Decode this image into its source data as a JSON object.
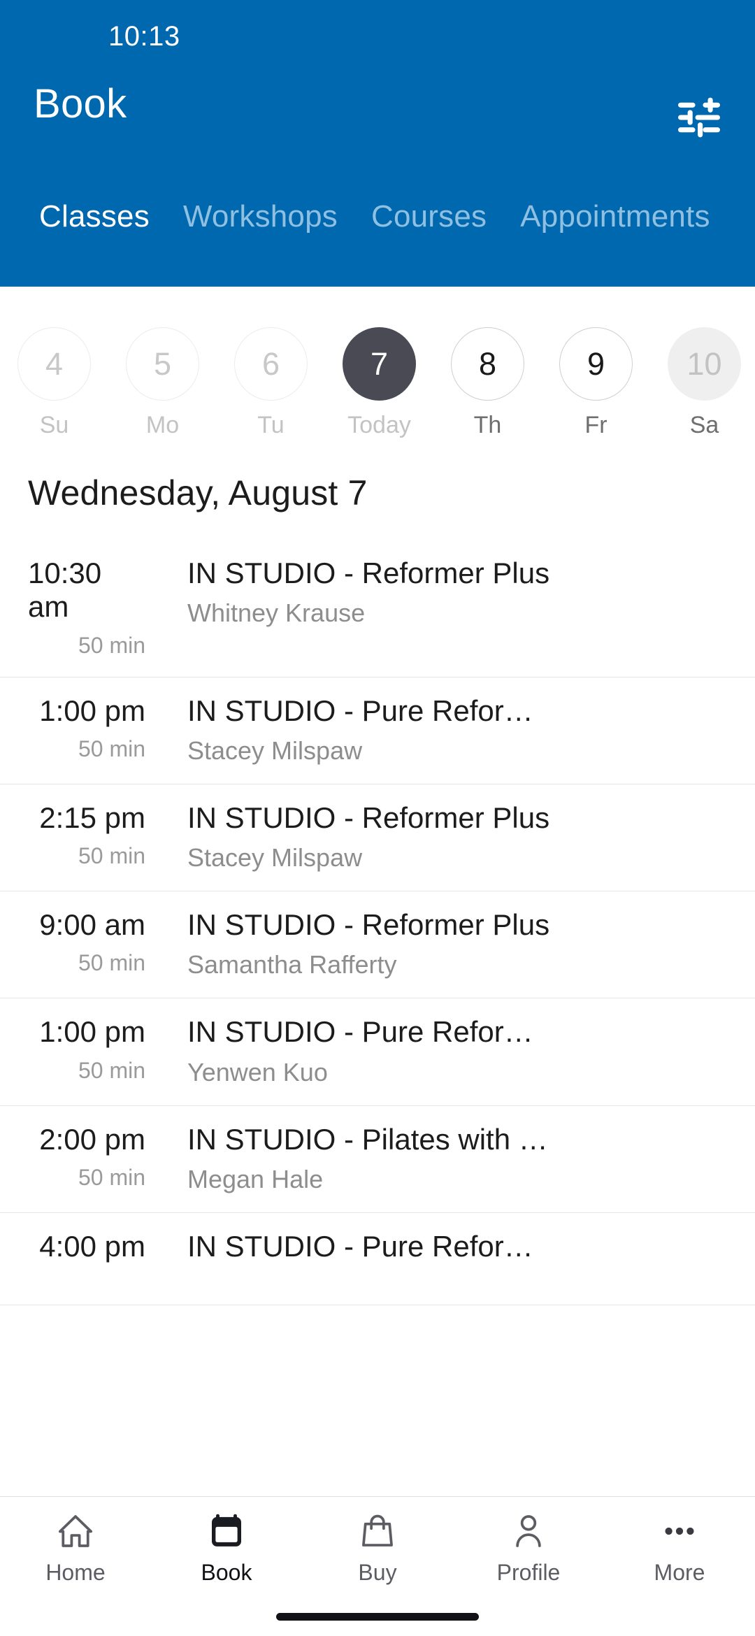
{
  "status_bar": {
    "time": "10:13"
  },
  "header": {
    "title": "Book",
    "filter_icon": "filter-tune-icon",
    "accent_color": "#0068AE",
    "tabs": [
      {
        "label": "Classes",
        "active": true
      },
      {
        "label": "Workshops",
        "active": false
      },
      {
        "label": "Courses",
        "active": false
      },
      {
        "label": "Appointments",
        "active": false
      }
    ]
  },
  "date_strip": {
    "days": [
      {
        "number": "4",
        "weekday": "Su",
        "state": "past"
      },
      {
        "number": "5",
        "weekday": "Mo",
        "state": "past"
      },
      {
        "number": "6",
        "weekday": "Tu",
        "state": "past"
      },
      {
        "number": "7",
        "weekday": "Today",
        "state": "selected"
      },
      {
        "number": "8",
        "weekday": "Th",
        "state": "future"
      },
      {
        "number": "9",
        "weekday": "Fr",
        "state": "future"
      },
      {
        "number": "10",
        "weekday": "Sa",
        "state": "disabled"
      }
    ],
    "selected_color": "#4A4A55"
  },
  "schedule": {
    "date_heading": "Wednesday, August 7",
    "classes": [
      {
        "time": "10:30 am",
        "duration": "50 min",
        "title": "IN STUDIO - Reformer Plus",
        "instructor": "Whitney Krause"
      },
      {
        "time": "1:00 pm",
        "duration": "50 min",
        "title": "IN STUDIO - Pure Refor…",
        "instructor": "Stacey Milspaw"
      },
      {
        "time": "2:15 pm",
        "duration": "50 min",
        "title": "IN STUDIO - Reformer Plus",
        "instructor": "Stacey Milspaw"
      },
      {
        "time": "9:00 am",
        "duration": "50 min",
        "title": "IN STUDIO - Reformer Plus",
        "instructor": "Samantha Rafferty"
      },
      {
        "time": "1:00 pm",
        "duration": "50 min",
        "title": "IN STUDIO - Pure Refor…",
        "instructor": "Yenwen Kuo"
      },
      {
        "time": "2:00 pm",
        "duration": "50 min",
        "title": "IN STUDIO - Pilates with …",
        "instructor": "Megan Hale"
      },
      {
        "time": "4:00 pm",
        "duration": "",
        "title": "IN STUDIO - Pure Refor…",
        "instructor": ""
      }
    ]
  },
  "bottom_nav": {
    "items": [
      {
        "label": "Home",
        "icon": "home-icon",
        "active": false
      },
      {
        "label": "Book",
        "icon": "calendar-icon",
        "active": true
      },
      {
        "label": "Buy",
        "icon": "shopping-bag-icon",
        "active": false
      },
      {
        "label": "Profile",
        "icon": "person-icon",
        "active": false
      },
      {
        "label": "More",
        "icon": "more-dots-icon",
        "active": false
      }
    ]
  }
}
